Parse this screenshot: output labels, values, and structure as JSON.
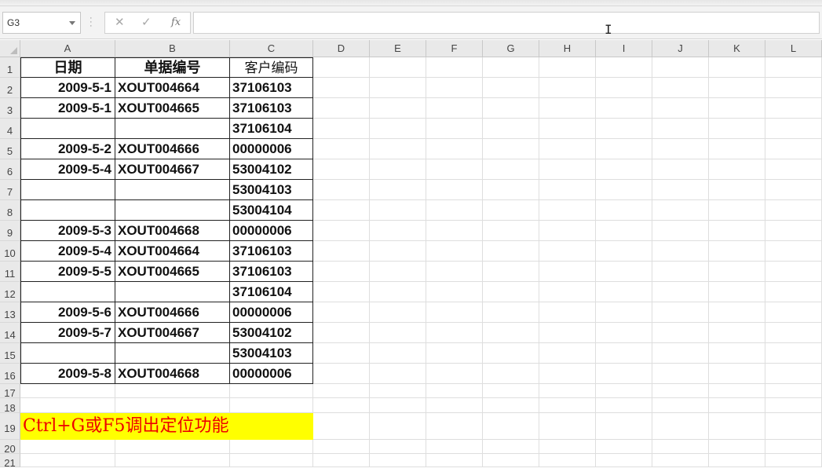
{
  "namebox": {
    "value": "G3"
  },
  "formula_bar": {
    "cancel_icon": "✕",
    "enter_icon": "✓",
    "fx_label": "fx",
    "content": ""
  },
  "columns": [
    "A",
    "B",
    "C",
    "D",
    "E",
    "F",
    "G",
    "H",
    "I",
    "J",
    "K",
    "L"
  ],
  "rows": [
    "1",
    "2",
    "3",
    "4",
    "5",
    "6",
    "7",
    "8",
    "9",
    "10",
    "11",
    "12",
    "13",
    "14",
    "15",
    "16",
    "17",
    "18",
    "19",
    "20",
    "21"
  ],
  "headers": {
    "A": "日期",
    "B": "单据编号",
    "C": "客户编码"
  },
  "table": [
    [
      "2009-5-1",
      "XOUT004664",
      "37106103"
    ],
    [
      "2009-5-1",
      "XOUT004665",
      "37106103"
    ],
    [
      "",
      "",
      "37106104"
    ],
    [
      "2009-5-2",
      "XOUT004666",
      "00000006"
    ],
    [
      "2009-5-4",
      "XOUT004667",
      "53004102"
    ],
    [
      "",
      "",
      "53004103"
    ],
    [
      "",
      "",
      "53004104"
    ],
    [
      "2009-5-3",
      "XOUT004668",
      "00000006"
    ],
    [
      "2009-5-4",
      "XOUT004664",
      "37106103"
    ],
    [
      "2009-5-5",
      "XOUT004665",
      "37106103"
    ],
    [
      "",
      "",
      "37106104"
    ],
    [
      "2009-5-6",
      "XOUT004666",
      "00000006"
    ],
    [
      "2009-5-7",
      "XOUT004667",
      "53004102"
    ],
    [
      "",
      "",
      "53004103"
    ],
    [
      "2009-5-8",
      "XOUT004668",
      "00000006"
    ]
  ],
  "note": {
    "text": "Ctrl+G或F5调出定位功能",
    "bg_color": "#ffff00",
    "text_color": "#ee0000"
  }
}
